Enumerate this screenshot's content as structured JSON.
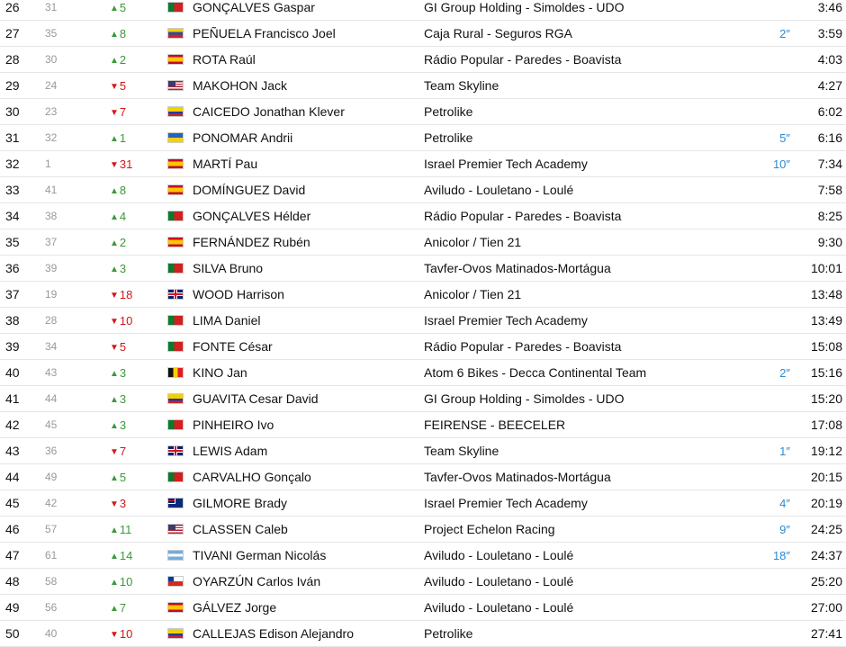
{
  "rows": [
    {
      "pos": "26",
      "prev": "31",
      "dir": "up",
      "delta": "5",
      "flag": "PT",
      "rider": "GONÇALVES Gaspar",
      "team": "GI Group Holding - Simoldes - UDO",
      "bonus": "",
      "time": "3:46"
    },
    {
      "pos": "27",
      "prev": "35",
      "dir": "up",
      "delta": "8",
      "flag": "VE",
      "rider": "PEÑUELA Francisco Joel",
      "team": "Caja Rural - Seguros RGA",
      "bonus": "2″",
      "time": "3:59"
    },
    {
      "pos": "28",
      "prev": "30",
      "dir": "up",
      "delta": "2",
      "flag": "ES",
      "rider": "ROTA Raúl",
      "team": "Rádio Popular - Paredes - Boavista",
      "bonus": "",
      "time": "4:03"
    },
    {
      "pos": "29",
      "prev": "24",
      "dir": "down",
      "delta": "5",
      "flag": "US",
      "rider": "MAKOHON Jack",
      "team": "Team Skyline",
      "bonus": "",
      "time": "4:27"
    },
    {
      "pos": "30",
      "prev": "23",
      "dir": "down",
      "delta": "7",
      "flag": "EC",
      "rider": "CAICEDO Jonathan Klever",
      "team": "Petrolike",
      "bonus": "",
      "time": "6:02"
    },
    {
      "pos": "31",
      "prev": "32",
      "dir": "up",
      "delta": "1",
      "flag": "UA",
      "rider": "PONOMAR Andrii",
      "team": "Petrolike",
      "bonus": "5″",
      "time": "6:16"
    },
    {
      "pos": "32",
      "prev": "1",
      "dir": "down",
      "delta": "31",
      "flag": "ES",
      "rider": "MARTÍ Pau",
      "team": "Israel Premier Tech Academy",
      "bonus": "10″",
      "time": "7:34"
    },
    {
      "pos": "33",
      "prev": "41",
      "dir": "up",
      "delta": "8",
      "flag": "ES",
      "rider": "DOMÍNGUEZ David",
      "team": "Aviludo - Louletano - Loulé",
      "bonus": "",
      "time": "7:58"
    },
    {
      "pos": "34",
      "prev": "38",
      "dir": "up",
      "delta": "4",
      "flag": "PT",
      "rider": "GONÇALVES Hélder",
      "team": "Rádio Popular - Paredes - Boavista",
      "bonus": "",
      "time": "8:25"
    },
    {
      "pos": "35",
      "prev": "37",
      "dir": "up",
      "delta": "2",
      "flag": "ES",
      "rider": "FERNÁNDEZ Rubén",
      "team": "Anicolor / Tien 21",
      "bonus": "",
      "time": "9:30"
    },
    {
      "pos": "36",
      "prev": "39",
      "dir": "up",
      "delta": "3",
      "flag": "PT",
      "rider": "SILVA Bruno",
      "team": "Tavfer-Ovos Matinados-Mortágua",
      "bonus": "",
      "time": "10:01"
    },
    {
      "pos": "37",
      "prev": "19",
      "dir": "down",
      "delta": "18",
      "flag": "GB",
      "rider": "WOOD Harrison",
      "team": "Anicolor / Tien 21",
      "bonus": "",
      "time": "13:48"
    },
    {
      "pos": "38",
      "prev": "28",
      "dir": "down",
      "delta": "10",
      "flag": "PT",
      "rider": "LIMA Daniel",
      "team": "Israel Premier Tech Academy",
      "bonus": "",
      "time": "13:49"
    },
    {
      "pos": "39",
      "prev": "34",
      "dir": "down",
      "delta": "5",
      "flag": "PT",
      "rider": "FONTE César",
      "team": "Rádio Popular - Paredes - Boavista",
      "bonus": "",
      "time": "15:08"
    },
    {
      "pos": "40",
      "prev": "43",
      "dir": "up",
      "delta": "3",
      "flag": "BE",
      "rider": "KINO Jan",
      "team": "Atom 6 Bikes - Decca Continental Team",
      "bonus": "2″",
      "time": "15:16"
    },
    {
      "pos": "41",
      "prev": "44",
      "dir": "up",
      "delta": "3",
      "flag": "CO",
      "rider": "GUAVITA Cesar David",
      "team": "GI Group Holding - Simoldes - UDO",
      "bonus": "",
      "time": "15:20"
    },
    {
      "pos": "42",
      "prev": "45",
      "dir": "up",
      "delta": "3",
      "flag": "PT",
      "rider": "PINHEIRO Ivo",
      "team": "FEIRENSE - BEECELER",
      "bonus": "",
      "time": "17:08"
    },
    {
      "pos": "43",
      "prev": "36",
      "dir": "down",
      "delta": "7",
      "flag": "GB",
      "rider": "LEWIS Adam",
      "team": "Team Skyline",
      "bonus": "1″",
      "time": "19:12"
    },
    {
      "pos": "44",
      "prev": "49",
      "dir": "up",
      "delta": "5",
      "flag": "PT",
      "rider": "CARVALHO Gonçalo",
      "team": "Tavfer-Ovos Matinados-Mortágua",
      "bonus": "",
      "time": "20:15"
    },
    {
      "pos": "45",
      "prev": "42",
      "dir": "down",
      "delta": "3",
      "flag": "AU",
      "rider": "GILMORE Brady",
      "team": "Israel Premier Tech Academy",
      "bonus": "4″",
      "time": "20:19"
    },
    {
      "pos": "46",
      "prev": "57",
      "dir": "up",
      "delta": "11",
      "flag": "US",
      "rider": "CLASSEN Caleb",
      "team": "Project Echelon Racing",
      "bonus": "9″",
      "time": "24:25"
    },
    {
      "pos": "47",
      "prev": "61",
      "dir": "up",
      "delta": "14",
      "flag": "AR",
      "rider": "TIVANI German Nicolás",
      "team": "Aviludo - Louletano - Loulé",
      "bonus": "18″",
      "time": "24:37"
    },
    {
      "pos": "48",
      "prev": "58",
      "dir": "up",
      "delta": "10",
      "flag": "CL",
      "rider": "OYARZÚN Carlos Iván",
      "team": "Aviludo - Louletano - Loulé",
      "bonus": "",
      "time": "25:20"
    },
    {
      "pos": "49",
      "prev": "56",
      "dir": "up",
      "delta": "7",
      "flag": "ES",
      "rider": "GÁLVEZ Jorge",
      "team": "Aviludo - Louletano - Loulé",
      "bonus": "",
      "time": "27:00"
    },
    {
      "pos": "50",
      "prev": "40",
      "dir": "down",
      "delta": "10",
      "flag": "CO",
      "rider": "CALLEJAS Edison Alejandro",
      "team": "Petrolike",
      "bonus": "",
      "time": "27:41"
    }
  ],
  "colors": {
    "up": "#3a9a3a",
    "down": "#d01818",
    "bonus": "#2a8ad0",
    "prev": "#999999"
  }
}
